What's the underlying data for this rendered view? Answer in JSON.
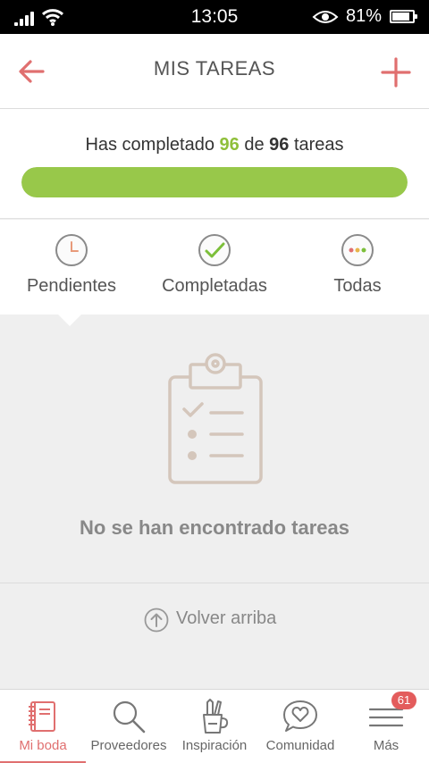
{
  "status_bar": {
    "time": "13:05",
    "battery": "81%"
  },
  "header": {
    "title": "MIS TAREAS",
    "back_icon": "arrow-left-icon",
    "add_icon": "plus-icon"
  },
  "progress": {
    "prefix": "Has completado",
    "completed": "96",
    "middle": "de",
    "total": "96",
    "suffix": "tareas",
    "fraction": 1.0,
    "bar_color": "#98c84a"
  },
  "tabs": [
    {
      "label": "Pendientes",
      "icon": "clock-icon"
    },
    {
      "label": "Completadas",
      "icon": "check-circle-icon"
    },
    {
      "label": "Todas",
      "icon": "dots-circle-icon"
    }
  ],
  "empty_state": {
    "message": "No se han encontrado tareas",
    "icon": "clipboard-checklist-icon"
  },
  "back_to_top": {
    "label": "Volver arriba"
  },
  "tabbar": [
    {
      "label": "Mi boda",
      "icon": "notebook-icon",
      "active": true
    },
    {
      "label": "Proveedores",
      "icon": "search-icon"
    },
    {
      "label": "Inspiración",
      "icon": "pencil-cup-icon"
    },
    {
      "label": "Comunidad",
      "icon": "heart-bubble-icon"
    },
    {
      "label": "Más",
      "icon": "menu-icon",
      "badge": "61"
    }
  ],
  "colors": {
    "accent": "#e06f6f",
    "success": "#98c84a"
  }
}
